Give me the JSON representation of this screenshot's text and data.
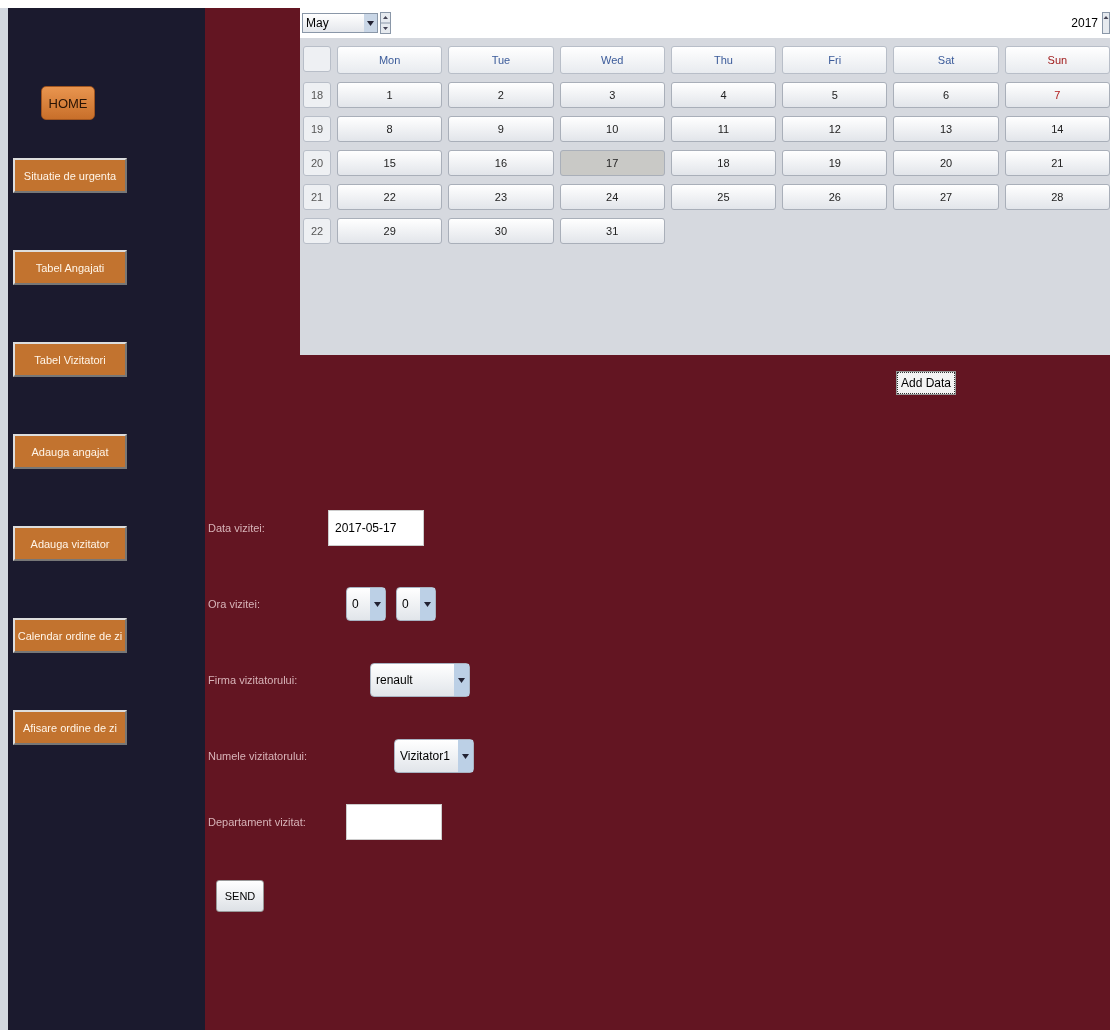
{
  "sidebar": {
    "items": [
      {
        "label": "HOME",
        "kind": "home"
      },
      {
        "label": "Situatie de urgenta",
        "kind": "nav"
      },
      {
        "label": "Tabel Angajati",
        "kind": "nav"
      },
      {
        "label": "Tabel Vizitatori",
        "kind": "nav"
      },
      {
        "label": "Adauga angajat",
        "kind": "nav"
      },
      {
        "label": "Adauga vizitator",
        "kind": "nav"
      },
      {
        "label": "Calendar ordine de zi",
        "kind": "nav"
      },
      {
        "label": "Afisare ordine de zi",
        "kind": "nav"
      }
    ]
  },
  "calendar": {
    "month": "May",
    "year": "2017",
    "weekdays": [
      {
        "label": "Mon",
        "kind": "weekday"
      },
      {
        "label": "Tue",
        "kind": "weekday"
      },
      {
        "label": "Wed",
        "kind": "weekday"
      },
      {
        "label": "Thu",
        "kind": "weekday"
      },
      {
        "label": "Fri",
        "kind": "weekday"
      },
      {
        "label": "Sat",
        "kind": "weekday"
      },
      {
        "label": "Sun",
        "kind": "sunday"
      }
    ],
    "weeks": [
      {
        "number": "18",
        "days": [
          {
            "label": "1",
            "selected": false,
            "kind": "normal"
          },
          {
            "label": "2",
            "selected": false,
            "kind": "normal"
          },
          {
            "label": "3",
            "selected": false,
            "kind": "normal"
          },
          {
            "label": "4",
            "selected": false,
            "kind": "normal"
          },
          {
            "label": "5",
            "selected": false,
            "kind": "normal"
          },
          {
            "label": "6",
            "selected": false,
            "kind": "normal"
          },
          {
            "label": "7",
            "selected": false,
            "kind": "sunday"
          }
        ]
      },
      {
        "number": "19",
        "days": [
          {
            "label": "8",
            "selected": false,
            "kind": "normal"
          },
          {
            "label": "9",
            "selected": false,
            "kind": "normal"
          },
          {
            "label": "10",
            "selected": false,
            "kind": "normal"
          },
          {
            "label": "11",
            "selected": false,
            "kind": "normal"
          },
          {
            "label": "12",
            "selected": false,
            "kind": "normal"
          },
          {
            "label": "13",
            "selected": false,
            "kind": "normal"
          },
          {
            "label": "14",
            "selected": false,
            "kind": "normal"
          }
        ]
      },
      {
        "number": "20",
        "days": [
          {
            "label": "15",
            "selected": false,
            "kind": "normal"
          },
          {
            "label": "16",
            "selected": false,
            "kind": "normal"
          },
          {
            "label": "17",
            "selected": true,
            "kind": "normal"
          },
          {
            "label": "18",
            "selected": false,
            "kind": "normal"
          },
          {
            "label": "19",
            "selected": false,
            "kind": "normal"
          },
          {
            "label": "20",
            "selected": false,
            "kind": "normal"
          },
          {
            "label": "21",
            "selected": false,
            "kind": "normal"
          }
        ]
      },
      {
        "number": "21",
        "days": [
          {
            "label": "22",
            "selected": false,
            "kind": "normal"
          },
          {
            "label": "23",
            "selected": false,
            "kind": "normal"
          },
          {
            "label": "24",
            "selected": false,
            "kind": "normal"
          },
          {
            "label": "25",
            "selected": false,
            "kind": "normal"
          },
          {
            "label": "26",
            "selected": false,
            "kind": "normal"
          },
          {
            "label": "27",
            "selected": false,
            "kind": "normal"
          },
          {
            "label": "28",
            "selected": false,
            "kind": "normal"
          }
        ]
      },
      {
        "number": "22",
        "days": [
          {
            "label": "29",
            "selected": false,
            "kind": "normal"
          },
          {
            "label": "30",
            "selected": false,
            "kind": "normal"
          },
          {
            "label": "31",
            "selected": false,
            "kind": "normal"
          }
        ]
      }
    ]
  },
  "add_button": "Add Data",
  "form": {
    "fields": [
      {
        "label": "Data vizitei:",
        "kind": "text",
        "value": "2017-05-17"
      },
      {
        "label": "Ora vizitei:",
        "kind": "time",
        "hour": "0",
        "minute": "0"
      },
      {
        "label": "Firma vizitatorului:",
        "kind": "select",
        "value": "renault"
      },
      {
        "label": "Numele vizitatorului:",
        "kind": "select",
        "value": "Vizitator1"
      },
      {
        "label": "Departament vizitat:",
        "kind": "text"
      }
    ],
    "submit": "SEND"
  }
}
